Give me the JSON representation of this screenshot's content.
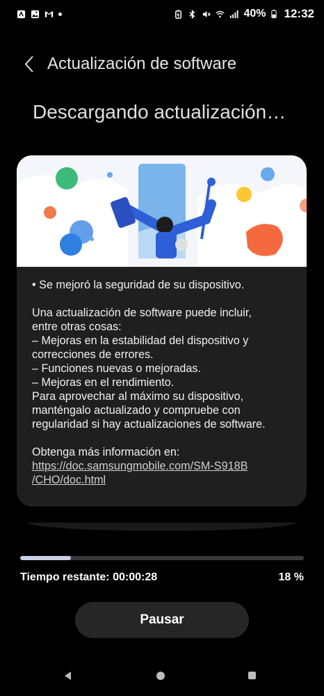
{
  "status_bar": {
    "battery_percent": "40%",
    "time": "12:32"
  },
  "header": {
    "title": "Actualización de software"
  },
  "page": {
    "title": "Descargando actualización…"
  },
  "card": {
    "bullet": "• Se mejoró la seguridad de su dispositivo.",
    "intro_1": "Una actualización de software puede incluir,",
    "intro_2": "entre otras cosas:",
    "item_1a": " – Mejoras en la estabilidad del dispositivo y",
    "item_1b": "correcciones de errores.",
    "item_2": " – Funciones nuevas o mejoradas.",
    "item_3": " – Mejoras en el rendimiento.",
    "advice_1": "Para aprovechar al máximo su dispositivo,",
    "advice_2": "manténgalo actualizado y compruebe con",
    "advice_3": "regularidad si hay actualizaciones de software.",
    "more_info": "Obtenga más información en:",
    "link_1": "https://doc.samsungmobile.com/SM-S918B",
    "link_2": "/CHO/doc.html"
  },
  "progress": {
    "value_percent": 18,
    "remaining": "Tiempo restante: 00:00:28",
    "percent_label": "18 %"
  },
  "actions": {
    "pause_label": "Pausar"
  },
  "colors": {
    "background": "#000000",
    "card": "#1f1f1f",
    "progress_fill": "#c9d1e6",
    "button": "#262626"
  },
  "icons": {
    "status_left": [
      "app-notification-icon",
      "gallery-icon",
      "gmail-icon",
      "notification-dot-icon"
    ],
    "status_right": [
      "battery-saver-icon",
      "bluetooth-icon",
      "mute-icon",
      "wifi-icon",
      "signal-icon",
      "battery-icon"
    ],
    "nav": [
      "back-icon",
      "home-icon",
      "recents-icon"
    ]
  }
}
